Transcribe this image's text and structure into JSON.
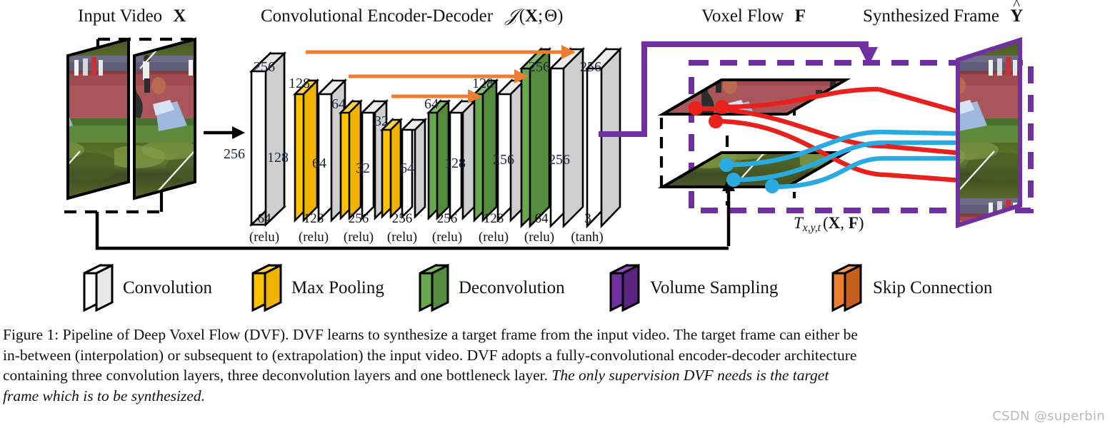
{
  "figure": {
    "id": "Figure 1",
    "headers": [
      {
        "name": "input-video",
        "text": "Input Video",
        "symbol": "X"
      },
      {
        "name": "encoder-decoder",
        "text": "Convolutional Encoder-Decoder",
        "symbol": "H(X; Θ)"
      },
      {
        "name": "voxel-flow",
        "text": "Voxel Flow",
        "symbol": "F"
      },
      {
        "name": "synthesized-frame",
        "text": "Synthesized Frame",
        "symbol": "Y"
      }
    ],
    "volume_sampling_label": "T",
    "volume_sampling_sub": "x,y,t",
    "volume_sampling_args": "(X, F)"
  },
  "network": {
    "top_size_labels": [
      "256",
      "128",
      "64",
      "32",
      "64",
      "128",
      "256",
      "256"
    ],
    "side_size_labels": [
      "256",
      "128",
      "64",
      "32",
      "64",
      "128",
      "256",
      "256"
    ],
    "input_side_label": "256",
    "channels": [
      "64",
      "128",
      "256",
      "256",
      "256",
      "128",
      "64",
      "3"
    ],
    "activations": [
      "(relu)",
      "(relu)",
      "(relu)",
      "(relu)",
      "(relu)",
      "(relu)",
      "(relu)",
      "(tanh)"
    ],
    "layer_kinds": [
      "conv",
      "pool-conv",
      "pool-conv",
      "pool-conv",
      "deconv-conv",
      "deconv-conv",
      "deconv-conv",
      "conv"
    ]
  },
  "legend": [
    {
      "name": "convolution",
      "label": "Convolution",
      "color": "#ffffff",
      "side": "#cfcfcf"
    },
    {
      "name": "max-pooling",
      "label": "Max Pooling",
      "color": "#ffc000",
      "side": "#e0a800"
    },
    {
      "name": "deconvolution",
      "label": "Deconvolution",
      "color": "#6aa84f",
      "side": "#4f7f3a"
    },
    {
      "name": "volume-sampling",
      "label": "Volume Sampling",
      "color": "#7030a0",
      "side": "#5a2480"
    },
    {
      "name": "skip-connection",
      "label": "Skip Connection",
      "color": "#ed7d31",
      "side": "#c85f1c"
    }
  ],
  "colors": {
    "skip": "#ed7d31",
    "volume_sampling": "#7030a0",
    "pooling": "#ffc000",
    "deconv": "#6aa84f",
    "conv": "#ffffff",
    "slab_side": "#cccccc",
    "flow_forward": "#e8211c",
    "flow_backward": "#29abe2",
    "text": "#1c2440"
  },
  "caption": {
    "line1": "Figure 1: Pipeline of Deep Voxel Flow (DVF). DVF learns to synthesize a target frame from the input video. The target frame can either be",
    "line2": "in-between (interpolation) or subsequent to (extrapolation) the input video. DVF adopts a fully-convolutional encoder-decoder architecture",
    "line3_plain": "containing three convolution layers, three deconvolution layers and one bottleneck layer. ",
    "line3_italic": "The only supervision DVF needs is the target",
    "line4_italic": "frame which is to be synthesized."
  },
  "watermark": "CSDN @superbin"
}
